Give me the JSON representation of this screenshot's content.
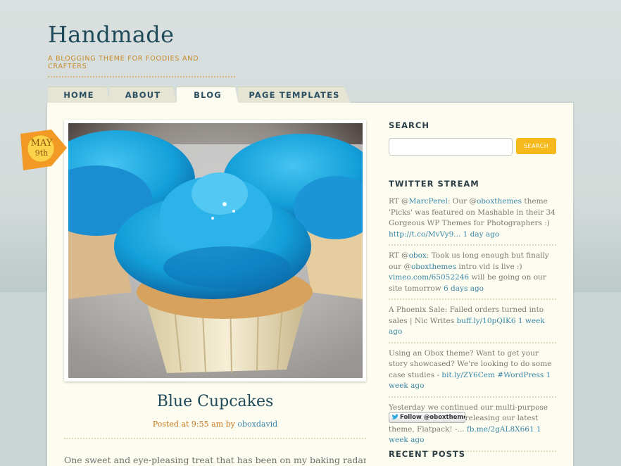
{
  "site": {
    "title": "Handmade",
    "tagline": "A BLOGGING THEME FOR FOODIES AND CRAFTERS"
  },
  "nav": {
    "tabs": [
      {
        "label": "HOME",
        "active": false
      },
      {
        "label": "ABOUT",
        "active": false
      },
      {
        "label": "BLOG",
        "active": true
      },
      {
        "label": "PAGE TEMPLATES",
        "active": false
      }
    ]
  },
  "post": {
    "date_month": "MAY",
    "date_day": "9th",
    "image_icon": "cupcake-photo",
    "title": "Blue Cupcakes",
    "meta_prefix": "Posted at 9:55 am by",
    "author": "oboxdavid",
    "excerpt": "One sweet and eye-pleasing treat that has been on my baking radar is Blue"
  },
  "sidebar": {
    "search": {
      "title": "SEARCH",
      "input_value": "",
      "button_label": "SEARCH"
    },
    "twitter": {
      "title": "TWITTER STREAM",
      "tweets": [
        {
          "t1": "RT @",
          "l1": "MarcPerel",
          "t2": ": Our @",
          "l2": "oboxthemes",
          "t3": " theme 'Picks' was featured on Mashable in their 34 Gorgeous WP Themes for Photographers :) ",
          "link": "http://t.co/MvVy9...",
          "time": "1 day ago"
        },
        {
          "t1": "RT @",
          "l1": "obox",
          "t2": ": Took us long enough but finally our @",
          "l2": "oboxthemes",
          "t3": " intro vid is live :) ",
          "link": "vimeo.com/65052246",
          "t4": " will be going on our site tomorrow ",
          "time": "6 days ago"
        },
        {
          "t1": "A Phoenix Sale: Failed orders turned into sales | Nic Writes ",
          "link": "buff.ly/10pQIK6",
          "time": "1 week ago"
        },
        {
          "t1": "Using an Obox theme? Want to get your story showcased? We're looking to do some case studies - ",
          "link": "bit.ly/ZY6Cem",
          "hashtag": "#WordPress",
          "time": "1 week ago"
        },
        {
          "t1": "Yesterday we continued our multi-purpose theme onslaught by releasing our latest theme, Flatpack! -... ",
          "link": "fb.me/2gAL8X661",
          "time": "1 week ago"
        }
      ],
      "follow_label": "Follow @oboxthemes"
    },
    "recent_posts": {
      "title": "RECENT POSTS"
    }
  },
  "colors": {
    "accent_yellow": "#f5b91c",
    "link_blue": "#3a87a8",
    "title_navy": "#1f4a5a",
    "meta_orange": "#c4781e",
    "paper": "#fdfcf0"
  }
}
